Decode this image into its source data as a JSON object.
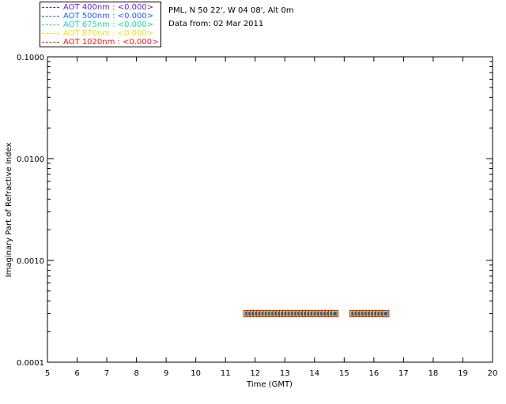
{
  "site_info": {
    "location": "PML, N 50 22', W 04 08', Alt 0m",
    "date_line": "Data from: 02 Mar 2011"
  },
  "legend": [
    {
      "label": "AOT  400nm : <0.000>",
      "color": "#6a1fd0"
    },
    {
      "label": "AOT  500nm : <0.000>",
      "color": "#1f5fe0"
    },
    {
      "label": "AOT  675nm : <0.000>",
      "color": "#18d8a8"
    },
    {
      "label": "AOT  870nm : <0.000>",
      "color": "#e8e010"
    },
    {
      "label": "AOT 1020nm : <0.000>",
      "color": "#e01818"
    }
  ],
  "chart_data": {
    "type": "scatter",
    "xlabel": "Time (GMT)",
    "ylabel": "Imaginary Part of Refractive Index",
    "xlim": [
      5,
      20
    ],
    "ylim": [
      0.0001,
      0.1
    ],
    "y_scale": "log",
    "x_ticks": [
      "5",
      "6",
      "7",
      "8",
      "9",
      "10",
      "11",
      "12",
      "13",
      "14",
      "15",
      "16",
      "17",
      "18",
      "19",
      "20"
    ],
    "y_ticks": [
      {
        "value": 0.0001,
        "label": "0.0001"
      },
      {
        "value": 0.001,
        "label": "0.0010"
      },
      {
        "value": 0.01,
        "label": "0.0100"
      },
      {
        "value": 0.1,
        "label": "0.1000"
      }
    ],
    "point_value": 0.0003,
    "series_colors": [
      "#6a1fd0",
      "#1f5fe0",
      "#18d8a8",
      "#e8e010",
      "#e01818"
    ],
    "times": [
      11.72,
      11.83,
      11.94,
      12.05,
      12.16,
      12.27,
      12.38,
      12.49,
      12.6,
      12.71,
      12.82,
      12.93,
      13.04,
      13.15,
      13.26,
      13.37,
      13.48,
      13.59,
      13.7,
      13.81,
      13.92,
      14.03,
      14.14,
      14.25,
      14.36,
      14.47,
      14.58,
      14.69,
      15.3,
      15.41,
      15.52,
      15.63,
      15.74,
      15.85,
      15.96,
      16.07,
      16.18,
      16.29,
      16.4
    ],
    "grid": false
  }
}
